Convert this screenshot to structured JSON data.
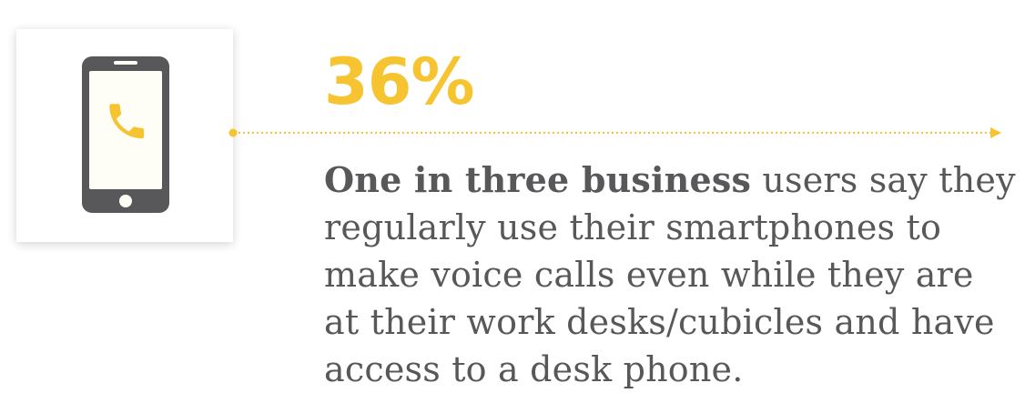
{
  "stat": {
    "value": "36%"
  },
  "statement": {
    "lead": "One in three business",
    "rest": "users say they regularly use their smartphones to make voice calls even while they are at their work desks/cubicles and have access to a desk phone."
  },
  "icons": {
    "main": "smartphone-call-icon"
  },
  "colors": {
    "accent": "#f7c431",
    "text": "#58585a",
    "phone_body": "#58585a",
    "phone_screen": "#fffef6"
  }
}
